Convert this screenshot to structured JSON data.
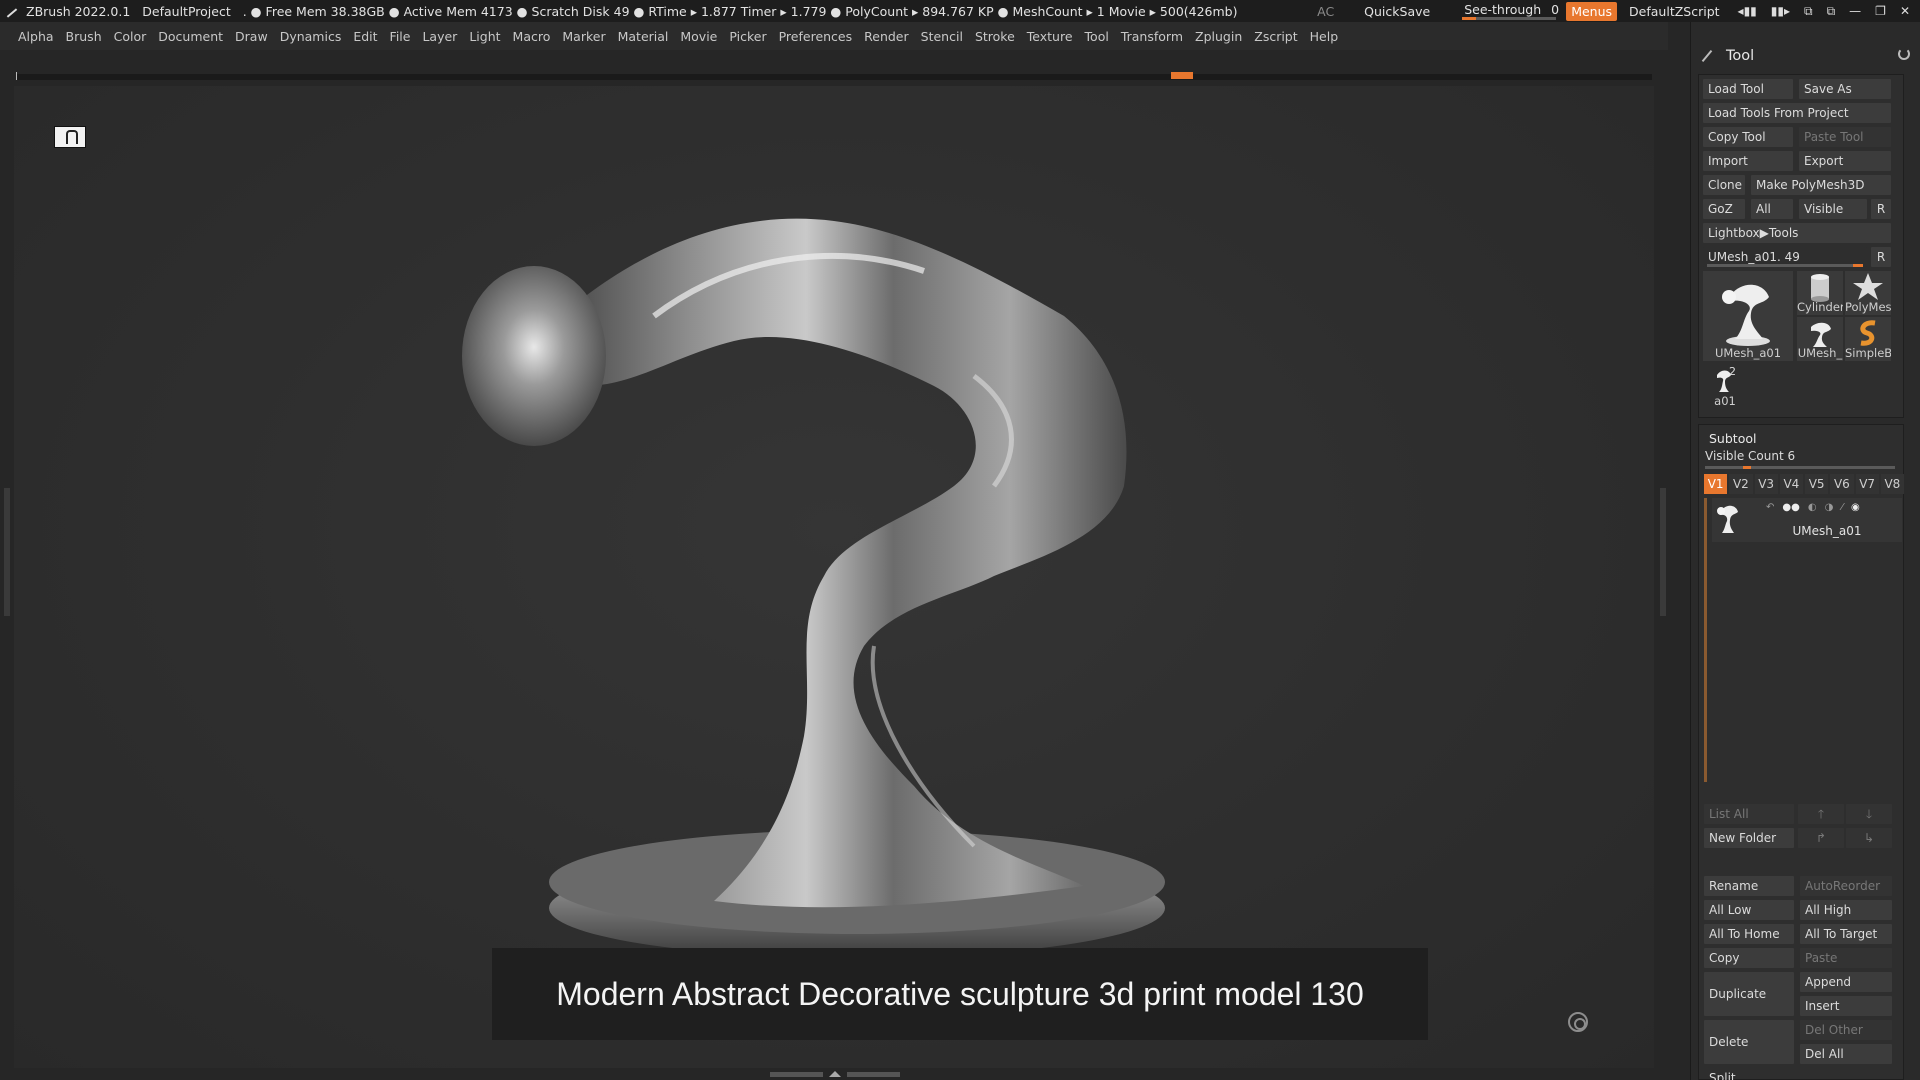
{
  "titlebar": {
    "app": "ZBrush 2022.0.1",
    "project": "DefaultProject",
    "stats": ". ● Free Mem 38.38GB ● Active Mem 4173 ● Scratch Disk 49 ●  RTime ▸ 1.877 Timer ▸ 1.779 ● PolyCount ▸ 894.767 KP  ● MeshCount ▸ 1  Movie ▸ 500(426mb)",
    "ac": "AC",
    "quicksave": "QuickSave",
    "seethrough_label": "See-through",
    "seethrough_value": "0",
    "menus": "Menus",
    "script": "DefaultZScript"
  },
  "menubar": [
    "Alpha",
    "Brush",
    "Color",
    "Document",
    "Draw",
    "Dynamics",
    "Edit",
    "File",
    "Layer",
    "Light",
    "Macro",
    "Marker",
    "Material",
    "Movie",
    "Picker",
    "Preferences",
    "Render",
    "Stencil",
    "Stroke",
    "Texture",
    "Tool",
    "Transform",
    "Zplugin",
    "Zscript",
    "Help"
  ],
  "canvas": {
    "caption": "Modern Abstract Decorative sculpture 3d print model 130"
  },
  "tool": {
    "title": "Tool",
    "load_tool": "Load Tool",
    "save_as": "Save As",
    "load_from_project": "Load Tools From Project",
    "copy_tool": "Copy Tool",
    "paste_tool": "Paste Tool",
    "import": "Import",
    "export": "Export",
    "clone": "Clone",
    "make_polymesh": "Make PolyMesh3D",
    "goz": "GoZ",
    "all": "All",
    "visible": "Visible",
    "r": "R",
    "lightbox_tools": "Lightbox▶Tools",
    "current_tool": "UMesh_a01. 49",
    "thumbs": {
      "main": "UMesh_a01",
      "cylinder": "Cylinder",
      "polymesh": "PolyMes",
      "umesh_small": "UMesh_",
      "simpleb": "SimpleB",
      "a01": "a01",
      "a01_count": "2"
    }
  },
  "subtool": {
    "title": "Subtool",
    "visible_count": "Visible Count 6",
    "tabs": [
      "V1",
      "V2",
      "V3",
      "V4",
      "V5",
      "V6",
      "V7",
      "V8"
    ],
    "active_tab": "V1",
    "item_name": "UMesh_a01",
    "list_all": "List All",
    "new_folder": "New Folder",
    "rename": "Rename",
    "autoreorder": "AutoReorder",
    "all_low": "All Low",
    "all_high": "All High",
    "all_to_home": "All To Home",
    "all_to_target": "All To Target",
    "copy": "Copy",
    "paste": "Paste",
    "duplicate": "Duplicate",
    "append": "Append",
    "insert": "Insert",
    "delete": "Delete",
    "del_other": "Del Other",
    "del_all": "Del All",
    "split": "Split"
  }
}
